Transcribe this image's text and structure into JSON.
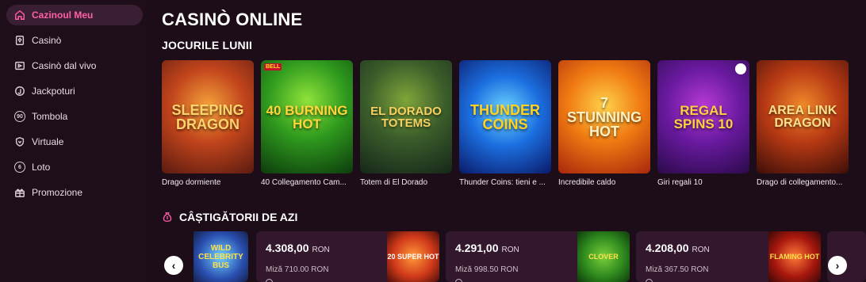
{
  "sidebar": {
    "items": [
      {
        "label": "Cazinoul Meu",
        "icon": "home-icon"
      },
      {
        "label": "Casinò",
        "icon": "cards-icon"
      },
      {
        "label": "Casinò dal vivo",
        "icon": "live-cards-icon"
      },
      {
        "label": "Jackpoturi",
        "icon": "jackpot-icon"
      },
      {
        "label": "Tombola",
        "icon": "bingo-90-icon",
        "icon_text": "90"
      },
      {
        "label": "Virtuale",
        "icon": "shield-icon"
      },
      {
        "label": "Loto",
        "icon": "lotto-6-icon",
        "icon_text": "6"
      },
      {
        "label": "Promozione",
        "icon": "gift-icon"
      }
    ]
  },
  "main": {
    "title": "CASINÒ ONLINE",
    "section": "JOCURILE LUNII"
  },
  "games": [
    {
      "label": "Drago dormiente",
      "logo": "SLEEPING DRAGON"
    },
    {
      "label": "40 Collegamento Cam...",
      "logo": "40 BURNING HOT",
      "badge": "BELL"
    },
    {
      "label": "Totem di El Dorado",
      "logo": "EL DORADO TOTEMS"
    },
    {
      "label": "Thunder Coins: tieni e ...",
      "logo": "THUNDER COINS"
    },
    {
      "label": "Incredibile caldo",
      "logo": "7 STUNNING HOT"
    },
    {
      "label": "Giri regali 10",
      "logo": "REGAL SPINS 10"
    },
    {
      "label": "Drago di collegamento...",
      "logo": "AREA LINK DRAGON"
    }
  ],
  "winners": {
    "title": "CÂȘTIGĂTORII DE AZI",
    "cards": [
      {
        "amount": "4.308,00",
        "currency": "RON",
        "bet": "Miză 710.00 RON",
        "game": "20 SUPER HOT"
      },
      {
        "amount": "4.291,00",
        "currency": "RON",
        "bet": "Miză 998.50 RON",
        "game": "CLOVER"
      },
      {
        "amount": "4.208,00",
        "currency": "RON",
        "bet": "Miză 367.50 RON",
        "game": "FLAMING HOT"
      }
    ],
    "partial_game": "WILD CELEBRITY BUS"
  },
  "colors": {
    "background": "#1c0d19",
    "active_item": "#ff5fa8"
  }
}
